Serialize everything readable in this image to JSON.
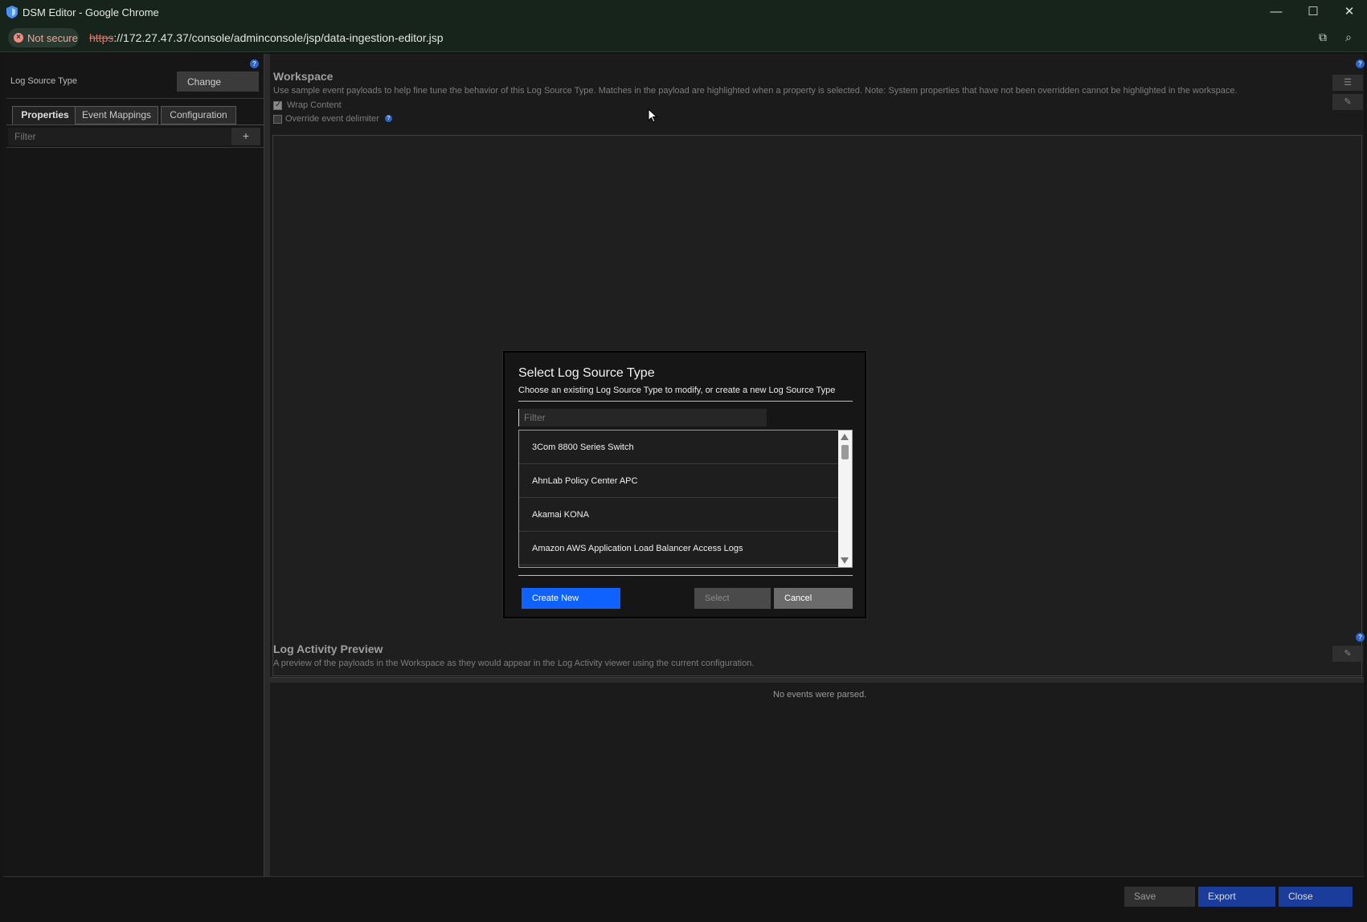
{
  "browser": {
    "window_title": "DSM Editor - Google Chrome",
    "security_chip": "Not secure",
    "url_scheme": "https",
    "url_rest": "://172.27.47.37/console/adminconsole/jsp/data-ingestion-editor.jsp",
    "controls": {
      "minimize": "—",
      "maximize": "☐",
      "close": "✕"
    }
  },
  "left": {
    "log_source_type_label": "Log Source Type",
    "change_label": "Change",
    "tabs": [
      "Properties",
      "Event Mappings",
      "Configuration"
    ],
    "filter_placeholder": "Filter",
    "add_label": "+"
  },
  "workspace": {
    "title": "Workspace",
    "description": "Use sample event payloads to help fine tune the behavior of this Log Source Type. Matches in the payload are highlighted when a property is selected. Note: System properties that have not been overridden cannot be highlighted in the workspace.",
    "wrap_content_label": "Wrap Content",
    "wrap_content_checked": true,
    "override_label": "Override event delimiter",
    "override_checked": false
  },
  "preview": {
    "title": "Log Activity Preview",
    "description": "A preview of the payloads in the Workspace as they would appear in the Log Activity viewer using the current configuration.",
    "empty_text": "No events were parsed."
  },
  "bottom": {
    "save_label": "Save",
    "export_label": "Export",
    "close_label": "Close"
  },
  "modal": {
    "title": "Select Log Source Type",
    "subtitle": "Choose an existing Log Source Type to modify, or create a new Log Source Type",
    "filter_placeholder": "Filter",
    "items": [
      "3Com 8800 Series Switch",
      "AhnLab Policy Center APC",
      "Akamai KONA",
      "Amazon AWS Application Load Balancer Access Logs"
    ],
    "create_new_label": "Create New",
    "select_label": "Select",
    "cancel_label": "Cancel"
  },
  "colors": {
    "primary_blue": "#0f62fe",
    "dark_blue": "#1a3d9c",
    "not_secure": "#f28b82"
  }
}
